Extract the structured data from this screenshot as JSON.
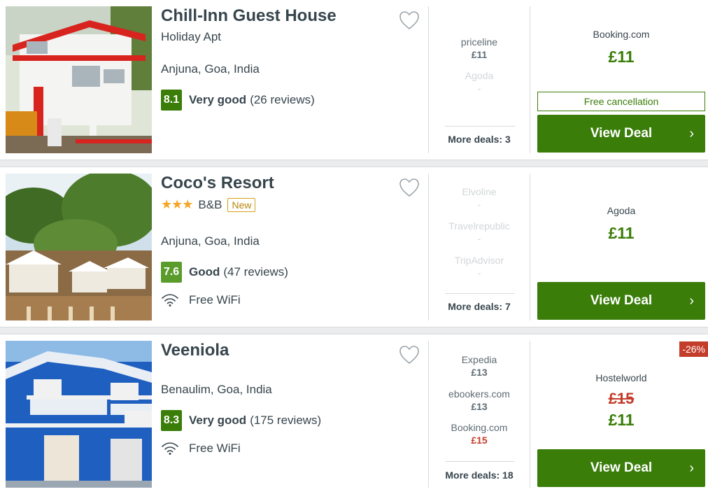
{
  "hotels": [
    {
      "name": "Chill-Inn Guest House",
      "type": "Holiday Apt",
      "location": "Anjuna, Goa, India",
      "score": "8.1",
      "score_color": "#3a7d09",
      "rating_label": "Very good",
      "reviews": "(26 reviews)",
      "deals": [
        {
          "provider": "priceline",
          "price": "£11"
        },
        {
          "provider": "Agoda",
          "price": "-"
        }
      ],
      "more_deals": "More deals: 3",
      "best_provider": "Booking.com",
      "best_price": "£11",
      "free_cancellation": "Free cancellation",
      "view_deal": "View Deal"
    },
    {
      "name": "Coco's Resort",
      "stars": "★★★",
      "type": "B&B",
      "new_badge": "New",
      "location": "Anjuna, Goa, India",
      "score": "7.6",
      "score_color": "#5a9c2b",
      "rating_label": "Good",
      "reviews": "(47 reviews)",
      "amenity": "Free WiFi",
      "deals": [
        {
          "provider": "Elvoline",
          "price": "-"
        },
        {
          "provider": "Travelrepublic",
          "price": "-"
        },
        {
          "provider": "TripAdvisor",
          "price": "-"
        }
      ],
      "more_deals": "More deals: 7",
      "best_provider": "Agoda",
      "best_price": "£11",
      "view_deal": "View Deal"
    },
    {
      "name": "Veeniola",
      "location": "Benaulim, Goa, India",
      "score": "8.3",
      "score_color": "#3a7d09",
      "rating_label": "Very good",
      "reviews": "(175 reviews)",
      "amenity": "Free WiFi",
      "deals": [
        {
          "provider": "Expedia",
          "price": "£13"
        },
        {
          "provider": "ebookers.com",
          "price": "£13"
        },
        {
          "provider": "Booking.com",
          "price": "£15"
        }
      ],
      "more_deals": "More deals: 18",
      "discount": "-26%",
      "best_provider": "Hostelworld",
      "best_old_price": "£15",
      "best_price": "£11",
      "view_deal": "View Deal"
    }
  ],
  "icons": {
    "favorite": "heart-outline-icon",
    "wifi": "wifi-icon",
    "chevron": "chevron-right-icon"
  },
  "colors": {
    "accent_green": "#3a7d09",
    "discount_red": "#c43c2a",
    "star_yellow": "#f5a623"
  }
}
